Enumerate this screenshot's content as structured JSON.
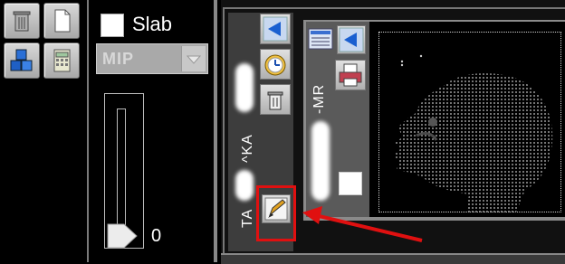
{
  "toolbar": {
    "tools": [
      {
        "icon": "trash-can-icon"
      },
      {
        "icon": "new-document-icon"
      },
      {
        "icon": "cubes-icon"
      },
      {
        "icon": "calculator-icon"
      }
    ]
  },
  "slab": {
    "label": "Slab",
    "checked": false
  },
  "projection": {
    "selected": "MIP"
  },
  "slider": {
    "value": "0"
  },
  "series": {
    "patient_label": "TA",
    "patient_label_tail": "^KA",
    "modality_label": "-MR",
    "icons": [
      "collapse-arrow-icon",
      "clock-icon",
      "delete-icon",
      "edit-pen-icon"
    ]
  },
  "image_series": {
    "icons": [
      "list-icon",
      "collapse-arrow-icon",
      "printer-icon",
      "square-icon"
    ]
  },
  "annotation": {
    "highlight_color": "#e01010"
  }
}
